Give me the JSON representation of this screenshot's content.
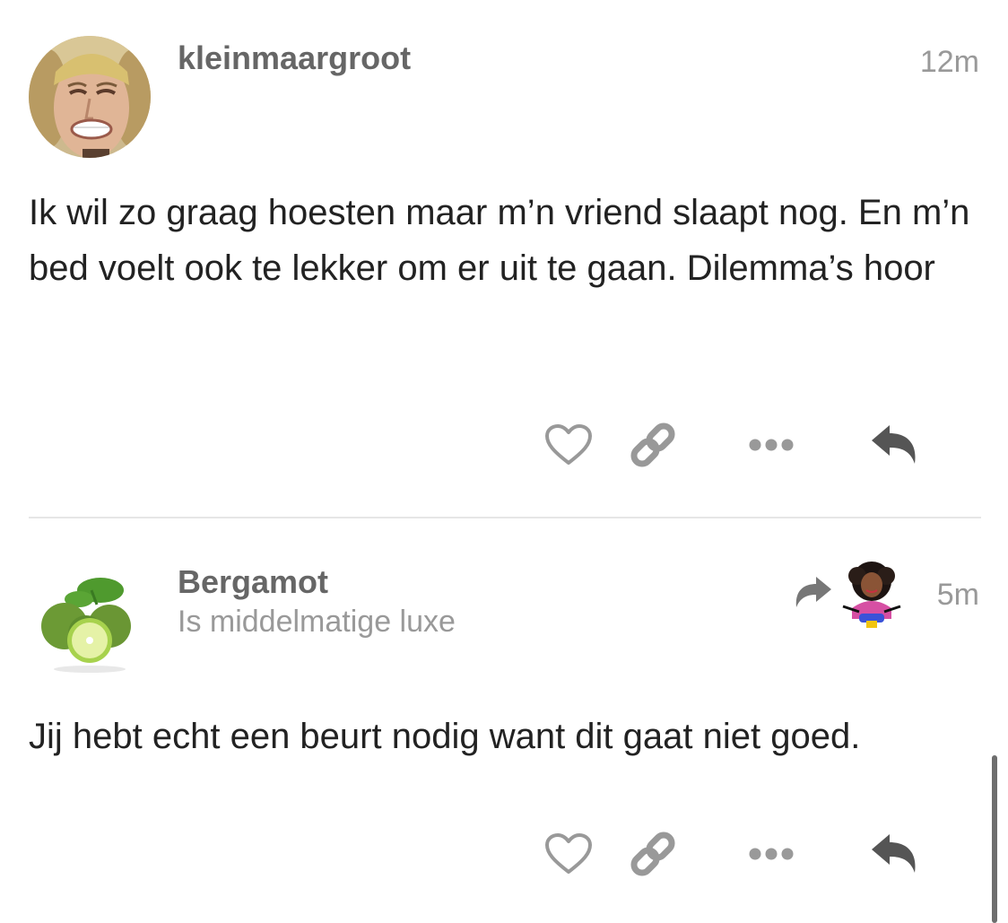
{
  "posts": [
    {
      "username": "kleinmaargroot",
      "time": "12m",
      "body": "Ik wil zo graag hoesten maar m’n vriend slaapt nog. En m’n bed voelt ook te lekker om er uit te gaan. Dilemma’s hoor",
      "actions": [
        "heart-icon",
        "link-icon",
        "more-icon",
        "reply-icon"
      ]
    },
    {
      "username": "Bergamot",
      "subtitle": "Is middelmatige luxe",
      "time": "5m",
      "body": "Jij hebt echt een beurt nodig want dit gaat niet goed.",
      "actions": [
        "heart-icon",
        "link-icon",
        "more-icon",
        "reply-icon"
      ]
    }
  ],
  "colors": {
    "icon": "#999999",
    "reply_icon": "#555555",
    "username": "#666666",
    "meta": "#999999",
    "text": "#222222",
    "divider": "#e6e6e6"
  }
}
